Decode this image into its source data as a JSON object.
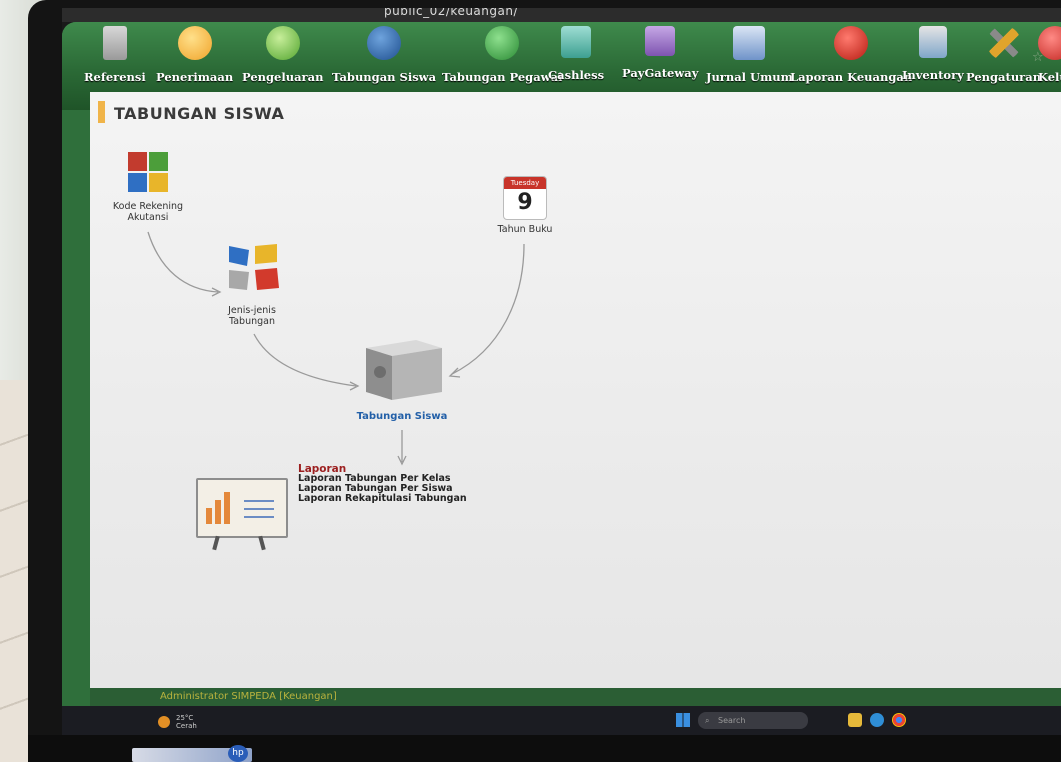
{
  "browser": {
    "url_fragment": "public_02/keuangan/"
  },
  "menu": {
    "items": [
      {
        "label": "Referensi",
        "icon": "clipboard-icon",
        "color": "#cfcfcf"
      },
      {
        "label": "Penerimaan",
        "icon": "download-arrow-icon",
        "color": "#f4b53d"
      },
      {
        "label": "Pengeluaran",
        "icon": "upload-arrow-icon",
        "color": "#7cc243"
      },
      {
        "label": "Tabungan Siswa",
        "icon": "hand-money-icon",
        "color": "#2866a8"
      },
      {
        "label": "Tabungan Pegawai",
        "icon": "hand-money-icon",
        "color": "#3fa845"
      },
      {
        "label": "Cashless",
        "icon": "wallet-icon",
        "color": "#4fb0a2"
      },
      {
        "label": "PayGateway",
        "icon": "card-icon",
        "color": "#9a6fc4"
      },
      {
        "label": "Jurnal Umum",
        "icon": "gear-document-icon",
        "color": "#5e86c0"
      },
      {
        "label": "Laporan Keuangan",
        "icon": "cup-icon",
        "color": "#d32a1f"
      },
      {
        "label": "Inventory",
        "icon": "box-icon",
        "color": "#7fa6c9"
      },
      {
        "label": "Pengaturan",
        "icon": "tools-icon",
        "color": "#e0a42c"
      },
      {
        "label": "Kelu",
        "icon": "exit-icon",
        "color": "#d63a35"
      }
    ]
  },
  "page": {
    "title": "TABUNGAN SISWA"
  },
  "diagram": {
    "kode_rekening": "Kode Rekening\nAkutansi",
    "jenis_tabungan": "Jenis-jenis\nTabungan",
    "tahun_buku": "Tahun Buku",
    "calendar_day_name": "Tuesday",
    "calendar_day_number": "9",
    "tabungan_siswa": "Tabungan Siswa"
  },
  "laporan": {
    "heading": "Laporan",
    "links": [
      "Laporan Tabungan Per Kelas",
      "Laporan Tabungan Per Siswa",
      "Laporan Rekapitulasi Tabungan"
    ]
  },
  "status": {
    "text": "Administrator SIMPEDA [Keuangan]"
  },
  "taskbar": {
    "temp": "25°C",
    "weather": "Cerah",
    "search_placeholder": "Search"
  }
}
